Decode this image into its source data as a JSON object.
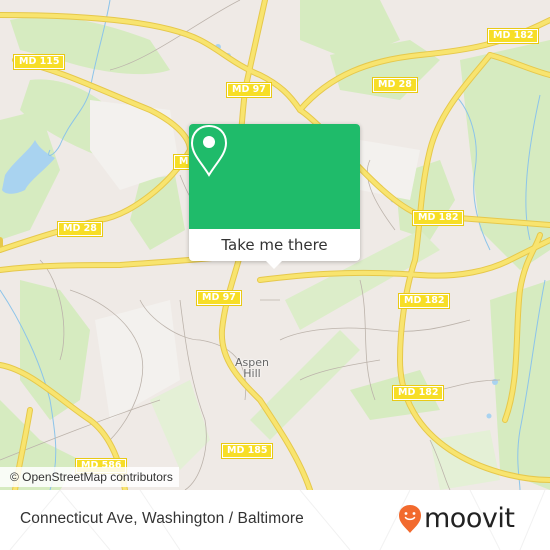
{
  "map": {
    "place_label": "Aspen Hill",
    "road_shields": [
      {
        "id": "md115",
        "label": "MD 115"
      },
      {
        "id": "md97-top",
        "label": "MD 97"
      },
      {
        "id": "md28-top",
        "label": "MD 28"
      },
      {
        "id": "md182-top",
        "label": "MD 182"
      },
      {
        "id": "md-partial",
        "label": "M"
      },
      {
        "id": "md28-left",
        "label": "MD 28"
      },
      {
        "id": "md182-mid",
        "label": "MD 182"
      },
      {
        "id": "md97-mid",
        "label": "MD 97"
      },
      {
        "id": "md182-right",
        "label": "MD 182"
      },
      {
        "id": "md182-lower",
        "label": "MD 182"
      },
      {
        "id": "md185",
        "label": "MD 185"
      },
      {
        "id": "md586",
        "label": "MD 586"
      }
    ],
    "attribution": "© OpenStreetMap contributors",
    "colors": {
      "background": "#efeae6",
      "park": "#cfe8b4",
      "water": "#a9d3f0",
      "road": "#f7de26"
    }
  },
  "popup": {
    "icon": "location-pin-icon",
    "button_label": "Take me there",
    "color": "#1fbb6a"
  },
  "footer": {
    "title": "Connecticut Ave, Washington / Baltimore",
    "brand": "moovit",
    "brand_color": "#f26a2e"
  }
}
